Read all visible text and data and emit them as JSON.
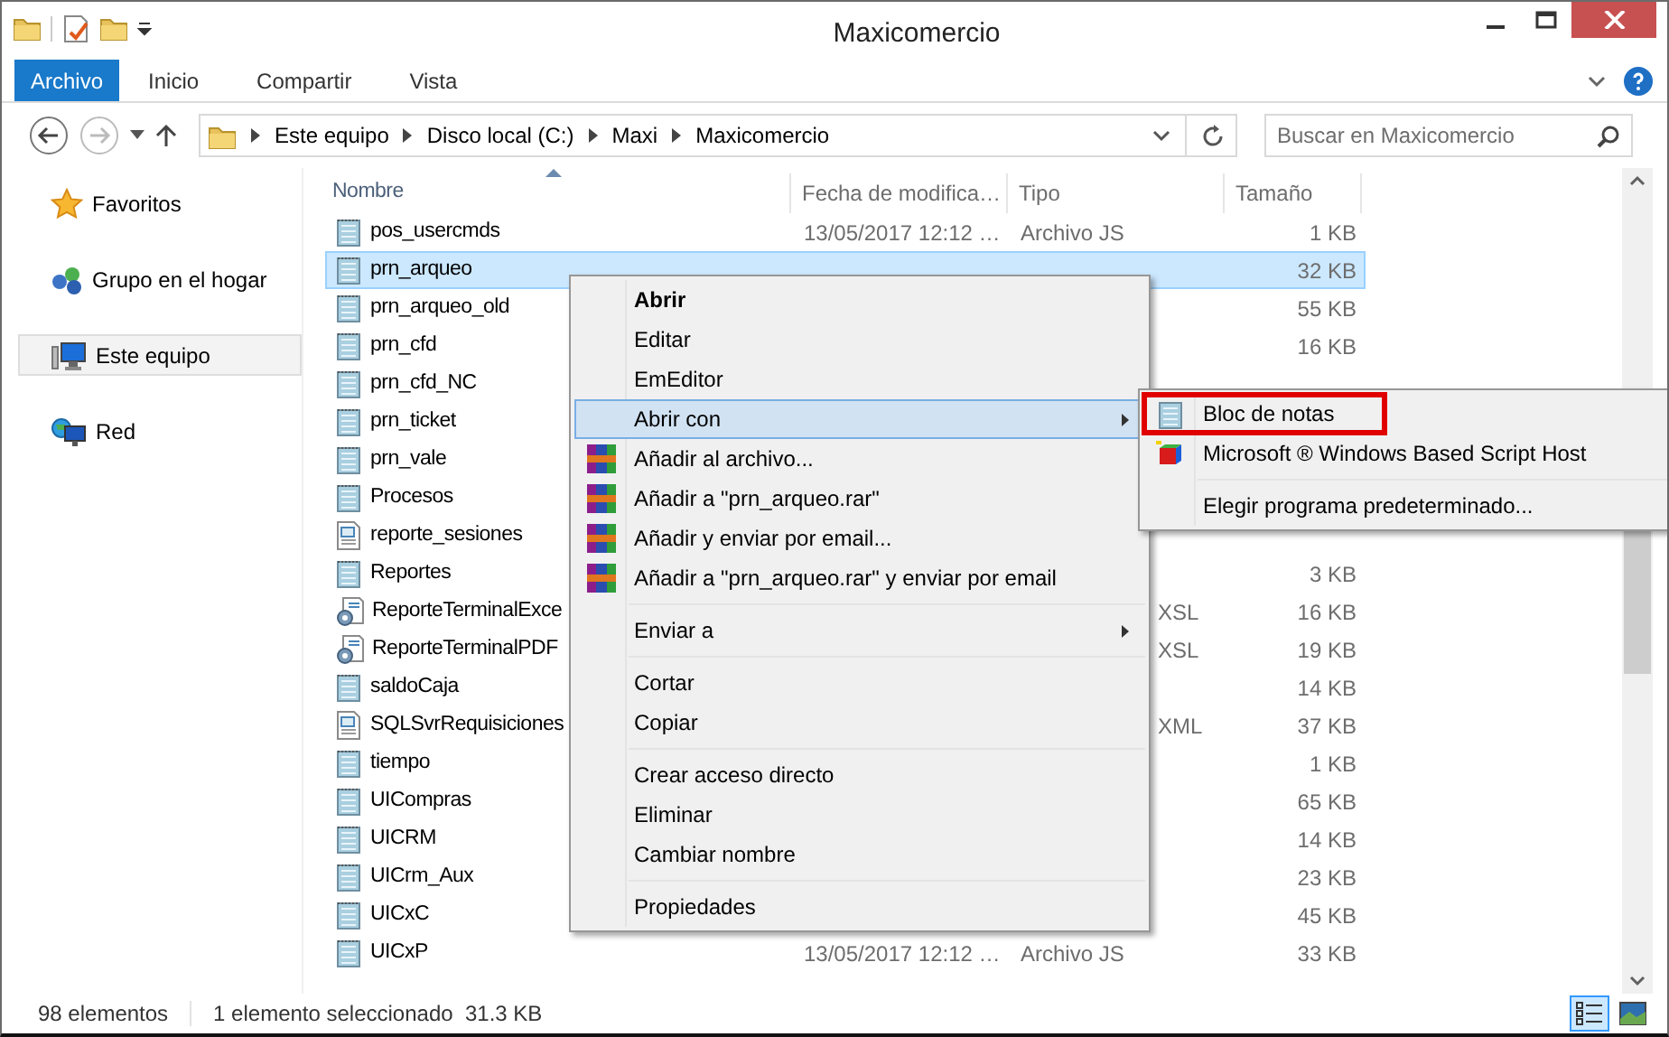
{
  "window": {
    "title": "Maxicomercio"
  },
  "ribbon": {
    "tabs": [
      {
        "label": "Archivo",
        "selected": true
      },
      {
        "label": "Inicio",
        "selected": false
      },
      {
        "label": "Compartir",
        "selected": false
      },
      {
        "label": "Vista",
        "selected": false
      }
    ]
  },
  "address_bar": {
    "path": [
      "Este equipo",
      "Disco local (C:)",
      "Maxi",
      "Maxicomercio"
    ]
  },
  "search": {
    "placeholder": "Buscar en Maxicomercio"
  },
  "navigation": [
    {
      "label": "Favoritos",
      "selected": false
    },
    {
      "label": "Grupo en el hogar",
      "selected": false
    },
    {
      "label": "Este equipo",
      "selected": true
    },
    {
      "label": "Red",
      "selected": false
    }
  ],
  "file_list": {
    "columns": [
      "Nombre",
      "Fecha de modifica…",
      "Tipo",
      "Tamaño"
    ],
    "rows": [
      {
        "name": "pos_usercmds",
        "kind": "js",
        "date": "13/05/2017 12:12 …",
        "type": "Archivo JS",
        "size": "1 KB",
        "selected": false
      },
      {
        "name": "prn_arqueo",
        "kind": "js",
        "size": "32 KB",
        "selected": true
      },
      {
        "name": "prn_arqueo_old",
        "kind": "js",
        "size": "55 KB",
        "selected": false
      },
      {
        "name": "prn_cfd",
        "kind": "js",
        "size": "16 KB",
        "selected": false
      },
      {
        "name": "prn_cfd_NC",
        "kind": "js",
        "selected": false
      },
      {
        "name": "prn_ticket",
        "kind": "js",
        "selected": false
      },
      {
        "name": "prn_vale",
        "kind": "js",
        "selected": false
      },
      {
        "name": "Procesos",
        "kind": "js",
        "selected": false
      },
      {
        "name": "reporte_sesiones",
        "kind": "doc",
        "selected": false
      },
      {
        "name": "Reportes",
        "kind": "js",
        "size": "3 KB",
        "selected": false
      },
      {
        "name": "ReporteTerminalExce",
        "kind": "xsl",
        "type": "XSL",
        "size": "16 KB",
        "selected": false
      },
      {
        "name": "ReporteTerminalPDF",
        "kind": "xsl",
        "type": "XSL",
        "size": "19 KB",
        "selected": false
      },
      {
        "name": "saldoCaja",
        "kind": "js",
        "size": "14 KB",
        "selected": false
      },
      {
        "name": "SQLSvrRequisiciones",
        "kind": "doc",
        "type": "XML",
        "size": "37 KB",
        "selected": false
      },
      {
        "name": "tiempo",
        "kind": "js",
        "size": "1 KB",
        "selected": false
      },
      {
        "name": "UICompras",
        "kind": "js",
        "size": "65 KB",
        "selected": false
      },
      {
        "name": "UICRM",
        "kind": "js",
        "size": "14 KB",
        "selected": false
      },
      {
        "name": "UICrm_Aux",
        "kind": "js",
        "size": "23 KB",
        "selected": false
      },
      {
        "name": "UICxC",
        "kind": "js",
        "size": "45 KB",
        "selected": false
      },
      {
        "name": "UICxP",
        "kind": "js",
        "date": "13/05/2017 12:12 …",
        "type": "Archivo JS",
        "size": "33 KB",
        "selected": false
      }
    ]
  },
  "context_menu": {
    "items": [
      {
        "kind": "item",
        "label": "Abrir",
        "bold": true,
        "selected": false
      },
      {
        "kind": "item",
        "label": "Editar",
        "selected": false
      },
      {
        "kind": "item",
        "label": "EmEditor",
        "selected": false
      },
      {
        "kind": "item",
        "label": "Abrir con",
        "submenu": true,
        "selected": true
      },
      {
        "kind": "archive-item",
        "label": "Añadir al archivo...",
        "selected": false
      },
      {
        "kind": "archive-item",
        "label": "Añadir a \"prn_arqueo.rar\"",
        "selected": false
      },
      {
        "kind": "archive-item",
        "label": "Añadir y enviar por email...",
        "selected": false
      },
      {
        "kind": "archive-item",
        "label": "Añadir a \"prn_arqueo.rar\" y enviar por email",
        "selected": false
      },
      {
        "kind": "separator"
      },
      {
        "kind": "item",
        "label": "Enviar a",
        "submenu": true,
        "selected": false
      },
      {
        "kind": "separator"
      },
      {
        "kind": "item",
        "label": "Cortar",
        "selected": false
      },
      {
        "kind": "item",
        "label": "Copiar",
        "selected": false
      },
      {
        "kind": "separator"
      },
      {
        "kind": "item",
        "label": "Crear acceso directo",
        "selected": false
      },
      {
        "kind": "item",
        "label": "Eliminar",
        "selected": false
      },
      {
        "kind": "item",
        "label": "Cambiar nombre",
        "selected": false
      },
      {
        "kind": "separator"
      },
      {
        "kind": "item",
        "label": "Propiedades",
        "selected": false
      }
    ]
  },
  "submenu": {
    "items": [
      {
        "kind": "notepad-item",
        "label": "Bloc de notas",
        "annotated": true
      },
      {
        "kind": "script-item",
        "label": "Microsoft ® Windows Based Script Host"
      },
      {
        "kind": "separator"
      },
      {
        "kind": "item",
        "label": "Elegir programa predeterminado..."
      }
    ]
  },
  "status_bar": {
    "count": "98 elementos",
    "selection": "1 elemento seleccionado  31.3 KB",
    "views": [
      {
        "kind": "details",
        "selected": true
      },
      {
        "kind": "tiles",
        "selected": false
      }
    ]
  }
}
